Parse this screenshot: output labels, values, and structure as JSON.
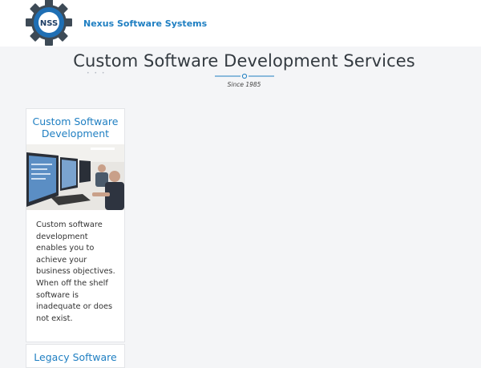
{
  "header": {
    "brand": "Nexus Software Systems",
    "logo_text": "NSS"
  },
  "hero": {
    "title": "Custom Software Development Services",
    "subtitle": "Since 1985"
  },
  "cards": [
    {
      "title": "Custom Software Development",
      "text": "Custom software development enables you to achieve your business objectives. When off the shelf software is inadequate or does not exist."
    },
    {
      "title": "Legacy Software"
    }
  ],
  "colors": {
    "accent": "#1f7fc2",
    "background": "#f4f5f7"
  }
}
